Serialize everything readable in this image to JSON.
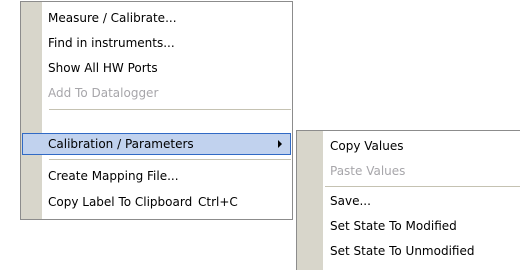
{
  "main_menu": {
    "items": [
      {
        "label": "Measure / Calibrate..."
      },
      {
        "label": "Find in instruments..."
      },
      {
        "label": "Show All HW Ports"
      },
      {
        "label": "Add To Datalogger"
      },
      {
        "label": "Calibration / Parameters"
      },
      {
        "label": "Create Mapping File..."
      },
      {
        "label": "Copy Label To Clipboard",
        "shortcut": "Ctrl+C"
      }
    ]
  },
  "sub_menu": {
    "items": [
      {
        "label": "Copy Values"
      },
      {
        "label": "Paste Values"
      },
      {
        "label": "Save..."
      },
      {
        "label": "Set State To Modified"
      },
      {
        "label": "Set State To Unmodified"
      }
    ]
  },
  "colors": {
    "gutter": "#d8d6cb",
    "highlight_fill": "#c1d2ee",
    "highlight_border": "#316ac5",
    "disabled_text": "#a7a6aa"
  }
}
